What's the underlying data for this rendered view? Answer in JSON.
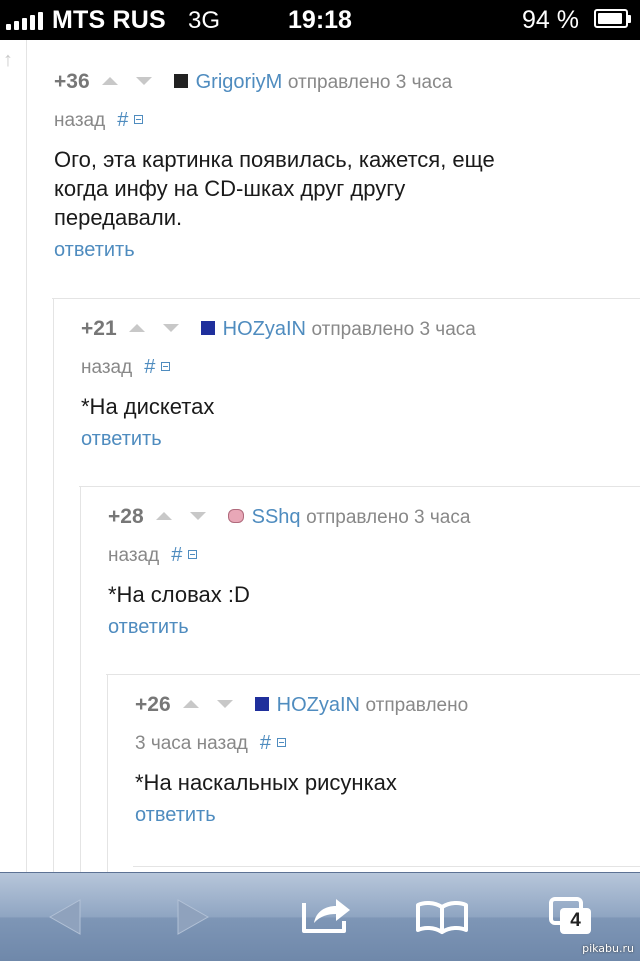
{
  "status_bar": {
    "carrier": "MTS RUS",
    "network": "3G",
    "time": "19:18",
    "battery_text": "94 %",
    "battery_level": 0.94
  },
  "comments": [
    {
      "rating": "+36",
      "username": "GrigoriyM",
      "meta_line1": "отправлено 3 часа",
      "meta_line2": "назад",
      "hash": "#",
      "text_lines": [
        "Ого, эта картинка появилась, кажется, еще",
        "когда инфу на CD-шках друг другу",
        "передавали."
      ],
      "reply": "ответить",
      "avatar_color": "#222222"
    },
    {
      "rating": "+21",
      "username": "HOZyaIN",
      "meta_line1": "отправлено 3 часа",
      "meta_line2": "назад",
      "hash": "#",
      "text_lines": [
        "*На дискетах"
      ],
      "reply": "ответить",
      "avatar_color": "#1f2f9c"
    },
    {
      "rating": "+28",
      "username": "SShq",
      "meta_line1": "отправлено 3 часа",
      "meta_line2": "назад",
      "hash": "#",
      "text_lines": [
        "*На словах :D"
      ],
      "reply": "ответить",
      "avatar_color": "#e8a7b7"
    },
    {
      "rating": "+26",
      "username": "HOZyaIN",
      "meta_line1": "отправлено",
      "meta_line2": "3 часа назад",
      "hash": "#",
      "text_lines": [
        "*На наскальных рисунках"
      ],
      "reply": "ответить",
      "avatar_color": "#1f2f9c"
    }
  ],
  "toolbar": {
    "tabs_count": "4",
    "icons": [
      "back-arrow-icon",
      "forward-arrow-icon",
      "share-icon",
      "bookmarks-icon",
      "pages-icon"
    ]
  },
  "watermark": "pikabu.ru",
  "colors": {
    "link": "#4f8cbf",
    "meta": "#888888",
    "toolbar_top": "#b7c6da",
    "toolbar_bottom": "#6f88aa"
  }
}
